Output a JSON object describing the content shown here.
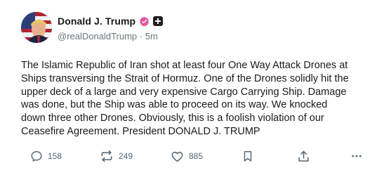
{
  "author": {
    "display_name": "Donald J. Trump",
    "handle": "@realDonaldTrump",
    "separator": "·",
    "time_ago": "5m",
    "verified_color": "#e8509b"
  },
  "post": {
    "text": "The Islamic Republic of Iran shot at least four One Way Attack Drones at\nShips transversing the Strait of Hormuz. One of the Drones solidly hit the\nupper deck of a large and very expensive Cargo Carrying Ship. Damage\nwas done, but the Ship was able to proceed on its way. We knocked\ndown three other Drones. Obviously, this is a foolish violation of our\nCeasefire Agreement. President DONALD J. TRUMP"
  },
  "actions": {
    "reply_count": "158",
    "repost_count": "249",
    "like_count": "885",
    "icons": [
      "reply-icon",
      "repost-icon",
      "like-icon",
      "bookmark-icon",
      "share-icon",
      "more-icon"
    ]
  },
  "colors": {
    "icon_gray": "#536471",
    "text": "#1a1a1a",
    "muted": "#6e767d"
  }
}
